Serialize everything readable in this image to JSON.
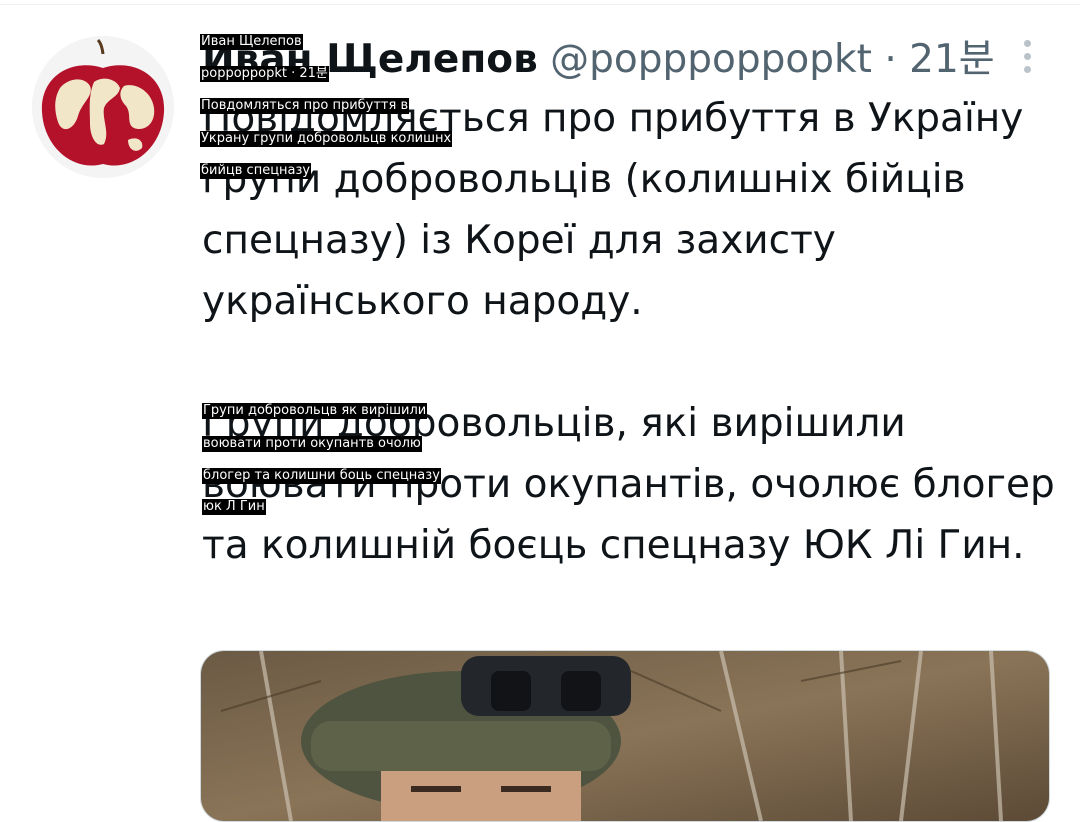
{
  "tweet": {
    "name": "Иван Щелепов",
    "handle": "@popppoppopkt",
    "separator": "·",
    "time": "21분",
    "paragraph1": "Повідомляється про прибуття в Україну групи добровольців (колишніх бійців спецназу) із Кореї для захисту українського народу.",
    "paragraph2": "Групи добровольців, які вирішили воювати проти окупантів, очолює блогер та колишній боєць спецназу ЮК Лі Гин."
  },
  "overlay": {
    "line1": "Иван Щелепов",
    "line2": "poppoppopkt · 21분",
    "line3": "Повдомляться про прибуття в",
    "line4": "Украну групи добровольцв колишнх",
    "line5": "бийцв спецназу",
    "line6": "Групи добровольцв як вирішили",
    "line7": "воювати проти окупантв очолю",
    "line8": "блогер та колишни боць спецназу",
    "line9": "юк Л Гин"
  },
  "icons": {
    "avatar": "apple-world-map-avatar",
    "more": "more-vertical-icon"
  },
  "colors": {
    "text": "#0f1419",
    "secondary": "#536471",
    "overlay_bg": "#000000"
  }
}
